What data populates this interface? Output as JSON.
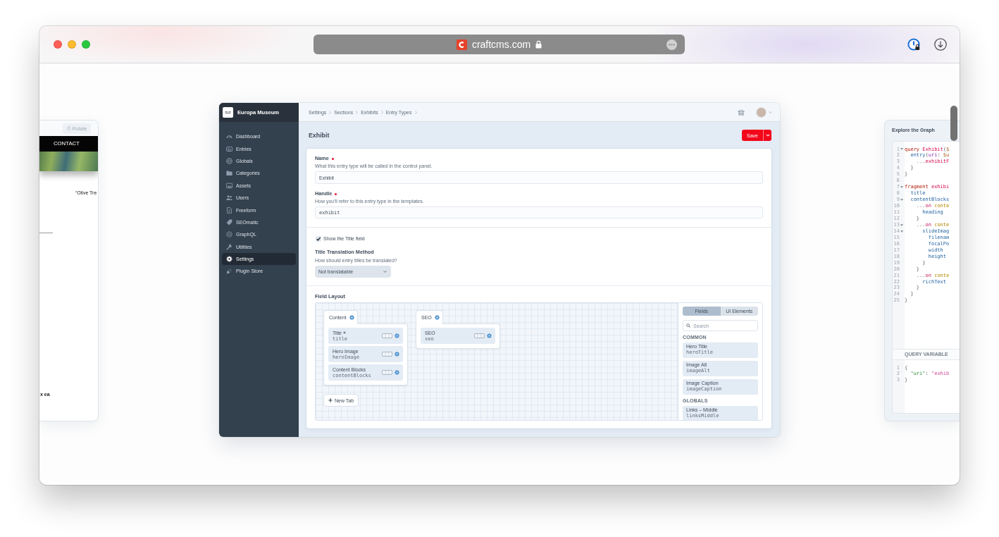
{
  "browser": {
    "url": "craftcms.com"
  },
  "left_preview": {
    "rotate_button": "Rotate",
    "nav_items": [
      "CONTACT"
    ],
    "caption": "“Olive Tre",
    "text_fragment": "x ea"
  },
  "app": {
    "site_name": "Europa Museum",
    "sidebar": {
      "items": [
        {
          "label": "Dashboard",
          "selected": false
        },
        {
          "label": "Entries",
          "selected": false
        },
        {
          "label": "Globals",
          "selected": false
        },
        {
          "label": "Categories",
          "selected": false
        },
        {
          "label": "Assets",
          "selected": false
        },
        {
          "label": "Users",
          "selected": false
        },
        {
          "label": "Freeform",
          "selected": false
        },
        {
          "label": "SEOmatic",
          "selected": false
        },
        {
          "label": "GraphQL",
          "selected": false
        },
        {
          "label": "Utilities",
          "selected": false
        },
        {
          "label": "Settings",
          "selected": true
        },
        {
          "label": "Plugin Store",
          "selected": false
        }
      ]
    },
    "breadcrumbs": [
      "Settings",
      "Sections",
      "Exhibits",
      "Entry Types"
    ],
    "title": "Exhibit",
    "save_button": "Save",
    "form": {
      "name_field": {
        "label": "Name",
        "required": true,
        "instructions": "What this entry type will be called in the control panel.",
        "value": "Exhibit"
      },
      "handle_field": {
        "label": "Handle",
        "required": true,
        "instructions": "How you'll refer to this entry type in the templates.",
        "value": "exhibit"
      },
      "show_title_field": {
        "label": "Show the Title field",
        "checked": true
      },
      "title_translation": {
        "label": "Title Translation Method",
        "instructions": "How should entry titles be translated?",
        "value": "Not translatable"
      },
      "field_layout": {
        "label": "Field Layout",
        "tabs": [
          {
            "name": "Content",
            "fields": [
              {
                "name": "Title",
                "handle": "title",
                "required": true
              },
              {
                "name": "Hero Image",
                "handle": "heroImage",
                "required": false
              },
              {
                "name": "Content Blocks",
                "handle": "contentBlocks",
                "required": false
              }
            ]
          },
          {
            "name": "SEO",
            "fields": [
              {
                "name": "SEO",
                "handle": "seo",
                "required": false
              }
            ]
          }
        ],
        "new_tab_button": "New Tab",
        "library": {
          "modes": [
            {
              "label": "Fields",
              "selected": true
            },
            {
              "label": "UI Elements",
              "selected": false
            }
          ],
          "search": {
            "placeholder": "Search"
          },
          "groups": [
            {
              "heading": "COMMON",
              "fields": [
                {
                  "name": "Hero Title",
                  "handle": "heroTitle"
                },
                {
                  "name": "Image Alt",
                  "handle": "imageAlt"
                },
                {
                  "name": "Image Caption",
                  "handle": "imageCaption"
                }
              ]
            },
            {
              "heading": "GLOBALS",
              "fields": [
                {
                  "name": "Links – Middle",
                  "handle": "linksMiddle"
                }
              ]
            }
          ]
        }
      }
    }
  },
  "right_preview": {
    "title": "Explore the Graph",
    "query_lines": [
      {
        "number": "1",
        "foldable": true,
        "tokens": [
          {
            "kind": "keyword",
            "text": "query"
          },
          {
            "kind": "def",
            "text": " Exhibit"
          },
          {
            "kind": "punct",
            "text": "("
          },
          {
            "kind": "variable",
            "text": "$"
          }
        ]
      },
      {
        "number": "2",
        "foldable": false,
        "tokens": [
          {
            "kind": "property",
            "text": "  entry"
          },
          {
            "kind": "punct",
            "text": "("
          },
          {
            "kind": "attribute",
            "text": "uri"
          },
          {
            "kind": "punct",
            "text": ": "
          },
          {
            "kind": "variable",
            "text": "$u"
          }
        ]
      },
      {
        "number": "3",
        "foldable": false,
        "tokens": [
          {
            "kind": "spread",
            "text": "    ..."
          },
          {
            "kind": "def",
            "text": "exhibitF"
          }
        ]
      },
      {
        "number": "4",
        "foldable": false,
        "tokens": [
          {
            "kind": "punct",
            "text": "  }"
          }
        ]
      },
      {
        "number": "5",
        "foldable": false,
        "tokens": [
          {
            "kind": "punct",
            "text": "}"
          }
        ]
      },
      {
        "number": "6",
        "foldable": false
      },
      {
        "number": "7",
        "foldable": true,
        "tokens": [
          {
            "kind": "keyword",
            "text": "fragment"
          },
          {
            "kind": "def",
            "text": " exhibi"
          }
        ]
      },
      {
        "number": "8",
        "foldable": false,
        "tokens": [
          {
            "kind": "property",
            "text": "  title"
          }
        ]
      },
      {
        "number": "9",
        "foldable": true,
        "tokens": [
          {
            "kind": "property",
            "text": "  contentBlocks"
          }
        ]
      },
      {
        "number": "10",
        "foldable": false,
        "tokens": [
          {
            "kind": "spread",
            "text": "    ..."
          },
          {
            "kind": "qualifier",
            "text": "on"
          },
          {
            "kind": "type",
            "text": " conte"
          }
        ]
      },
      {
        "number": "11",
        "foldable": false,
        "tokens": [
          {
            "kind": "property",
            "text": "      heading"
          }
        ]
      },
      {
        "number": "12",
        "foldable": false,
        "tokens": [
          {
            "kind": "punct",
            "text": "    }"
          }
        ]
      },
      {
        "number": "13",
        "foldable": true,
        "tokens": [
          {
            "kind": "spread",
            "text": "    ..."
          },
          {
            "kind": "qualifier",
            "text": "on"
          },
          {
            "kind": "type",
            "text": " conte"
          }
        ]
      },
      {
        "number": "14",
        "foldable": true,
        "tokens": [
          {
            "kind": "property",
            "text": "      slideImag"
          }
        ]
      },
      {
        "number": "15",
        "foldable": false,
        "tokens": [
          {
            "kind": "property",
            "text": "        filenam"
          }
        ]
      },
      {
        "number": "16",
        "foldable": false,
        "tokens": [
          {
            "kind": "property",
            "text": "        focalPo"
          }
        ]
      },
      {
        "number": "17",
        "foldable": false,
        "tokens": [
          {
            "kind": "property",
            "text": "        width"
          }
        ]
      },
      {
        "number": "18",
        "foldable": false,
        "tokens": [
          {
            "kind": "property",
            "text": "        height"
          }
        ]
      },
      {
        "number": "19",
        "foldable": false,
        "tokens": [
          {
            "kind": "punct",
            "text": "      }"
          }
        ]
      },
      {
        "number": "20",
        "foldable": false,
        "tokens": [
          {
            "kind": "punct",
            "text": "    }"
          }
        ]
      },
      {
        "number": "21",
        "foldable": false,
        "tokens": [
          {
            "kind": "spread",
            "text": "    ..."
          },
          {
            "kind": "qualifier",
            "text": "on"
          },
          {
            "kind": "type",
            "text": " conte"
          }
        ]
      },
      {
        "number": "22",
        "foldable": false,
        "tokens": [
          {
            "kind": "property",
            "text": "      richText"
          }
        ]
      },
      {
        "number": "23",
        "foldable": false,
        "tokens": [
          {
            "kind": "punct",
            "text": "    }"
          }
        ]
      },
      {
        "number": "24",
        "foldable": false,
        "tokens": [
          {
            "kind": "punct",
            "text": "  }"
          }
        ]
      },
      {
        "number": "25",
        "foldable": false,
        "tokens": [
          {
            "kind": "punct",
            "text": "}"
          }
        ]
      }
    ],
    "variables_heading": "QUERY VARIABLE",
    "variable_lines": [
      {
        "number": "1",
        "tokens": [
          {
            "kind": "punct",
            "text": "{"
          }
        ]
      },
      {
        "number": "2",
        "tokens": [
          {
            "kind": "jsonkey",
            "text": "  \"uri\""
          },
          {
            "kind": "punct",
            "text": ": "
          },
          {
            "kind": "string",
            "text": "\"exhib"
          }
        ]
      },
      {
        "number": "3",
        "tokens": [
          {
            "kind": "punct",
            "text": "}"
          }
        ]
      }
    ]
  }
}
